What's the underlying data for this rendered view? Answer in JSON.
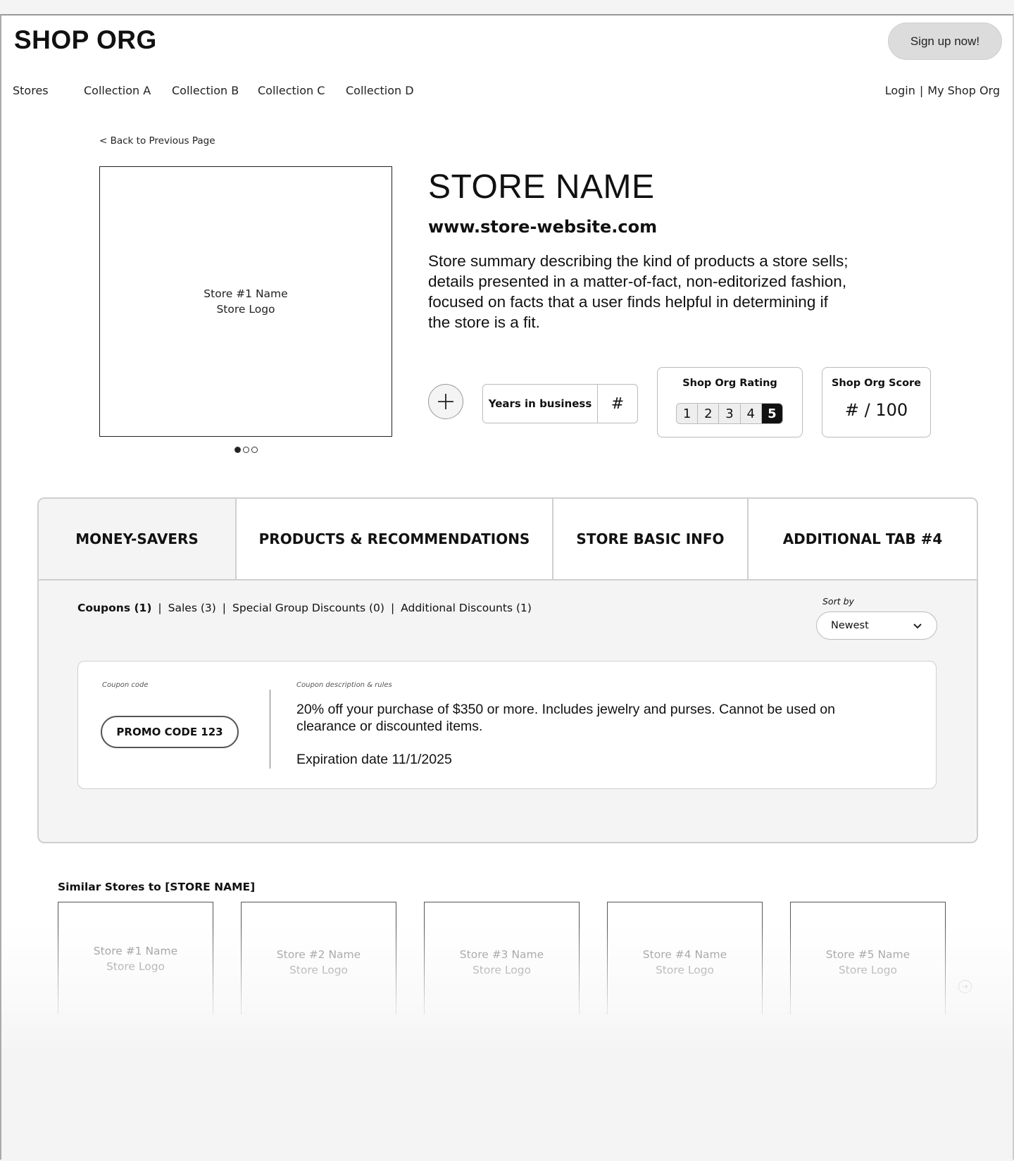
{
  "header": {
    "logo": "SHOP ORG",
    "signup_label": "Sign up now!",
    "nav": [
      "Stores",
      "Collection A",
      "Collection B",
      "Collection C",
      "Collection D"
    ],
    "login_label": "Login",
    "separator": "|",
    "account_label": "My Shop Org"
  },
  "back_link": "< Back to Previous Page",
  "store": {
    "image_name": "Store #1 Name",
    "image_logo": "Store Logo",
    "name": "STORE NAME",
    "website": "www.store-website.com",
    "summary": "Store summary describing the kind of products a store sells; details presented in a matter-of-fact, non-editorized fashion, focused on facts that a user finds helpful in determining if the store is a fit.",
    "years_label": "Years in business",
    "years_value": "#",
    "rating_title": "Shop Org Rating",
    "rating_options": [
      "1",
      "2",
      "3",
      "4",
      "5"
    ],
    "rating_selected": 5,
    "score_title": "Shop Org Score",
    "score_value": "# / 100",
    "carousel_count": 3,
    "carousel_active": 1
  },
  "tabs": [
    {
      "label": "MONEY-SAVERS",
      "active": true
    },
    {
      "label": "PRODUCTS & RECOMMENDATIONS",
      "active": false
    },
    {
      "label": "STORE BASIC INFO",
      "active": false
    },
    {
      "label": "ADDITIONAL TAB #4",
      "active": false
    }
  ],
  "filters": {
    "items": [
      "Coupons (1)",
      "Sales (3)",
      "Special Group Discounts (0)",
      "Additional Discounts (1)"
    ],
    "separator": "|",
    "sort_label": "Sort by",
    "sort_value": "Newest"
  },
  "coupon": {
    "code_caption": "Coupon code",
    "code": "PROMO CODE 123",
    "desc_caption": "Coupon description & rules",
    "description": "20% off your purchase of $350 or more. Includes jewelry and purses. Cannot be used on clearance or discounted items.",
    "expiration": "Expiration date 11/1/2025"
  },
  "similar": {
    "title": "Similar Stores to [STORE NAME]",
    "stores": [
      {
        "name": "Store #1 Name",
        "logo": "Store Logo"
      },
      {
        "name": "Store #2 Name",
        "logo": "Store Logo"
      },
      {
        "name": "Store #3 Name",
        "logo": "Store Logo"
      },
      {
        "name": "Store #4 Name",
        "logo": "Store Logo"
      },
      {
        "name": "Store #5 Name",
        "logo": "Store Logo"
      }
    ]
  }
}
